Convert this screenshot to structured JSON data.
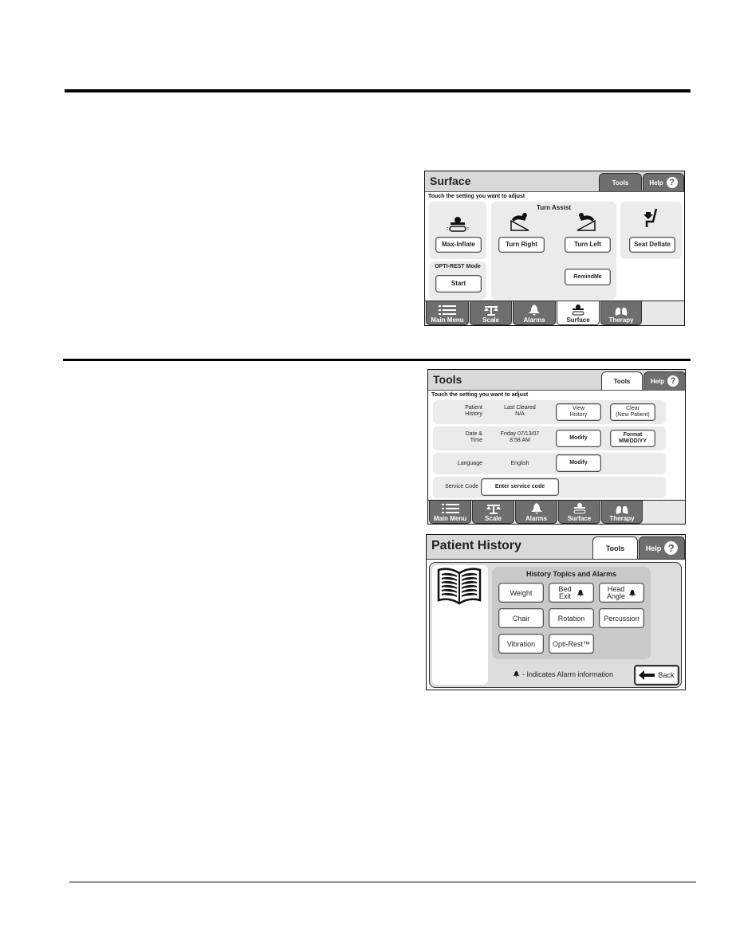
{
  "surface_screen": {
    "title": "Surface",
    "tabs": {
      "tools": "Tools",
      "help": "Help",
      "help_icon": "?"
    },
    "instruction": "Touch the setting you want to adjust",
    "turn_assist_heading": "Turn Assist",
    "buttons": {
      "max_inflate": "Max-Inflate",
      "turn_right": "Turn Right",
      "turn_left": "Turn Left",
      "seat_deflate": "Seat Deflate",
      "remind_me": "RemindMe",
      "start": "Start"
    },
    "opti_rest_label": "OPTI-REST Mode",
    "nav": [
      "Main Menu",
      "Scale",
      "Alarms",
      "Surface",
      "Therapy"
    ],
    "active_nav": "Surface"
  },
  "tools_screen": {
    "title": "Tools",
    "tabs": {
      "tools": "Tools",
      "help": "Help",
      "help_icon": "?"
    },
    "instruction": "Touch the setting you want to adjust",
    "rows": {
      "patient_history": {
        "label_line1": "Patient",
        "label_line2": "History",
        "value_line1": "Last Cleared",
        "value_line2": "N/A",
        "btn1_line1": "View",
        "btn1_line2": "History",
        "btn2_line1": "Clear",
        "btn2_line2": "(New Patient)"
      },
      "date_time": {
        "label_line1": "Date &",
        "label_line2": "Time",
        "value_line1": "Friday 07/13/07",
        "value_line2": "8:58 AM",
        "btn1": "Modify",
        "btn2_line1": "Format",
        "btn2_line2": "MM/DD/YY"
      },
      "language": {
        "label": "Language",
        "value": "English",
        "btn1": "Modify"
      },
      "service_code": {
        "label": "Service Code",
        "btn1": "Enter service code"
      }
    },
    "nav": [
      "Main Menu",
      "Scale",
      "Alarms",
      "Surface",
      "Therapy"
    ]
  },
  "patient_history_screen": {
    "title": "Patient History",
    "tabs": {
      "tools": "Tools",
      "help": "Help",
      "help_icon": "?"
    },
    "topics_heading": "History Topics and Alarms",
    "topics": {
      "weight": "Weight",
      "bed_exit_line1": "Bed",
      "bed_exit_line2": "Exit",
      "head_angle_line1": "Head",
      "head_angle_line2": "Angle",
      "chair": "Chair",
      "rotation": "Rotation",
      "percussion": "Percussion",
      "vibration": "Vibration",
      "opti_rest": "Opti-Rest™"
    },
    "legend": "- Indicates Alarm information",
    "back": "Back"
  }
}
